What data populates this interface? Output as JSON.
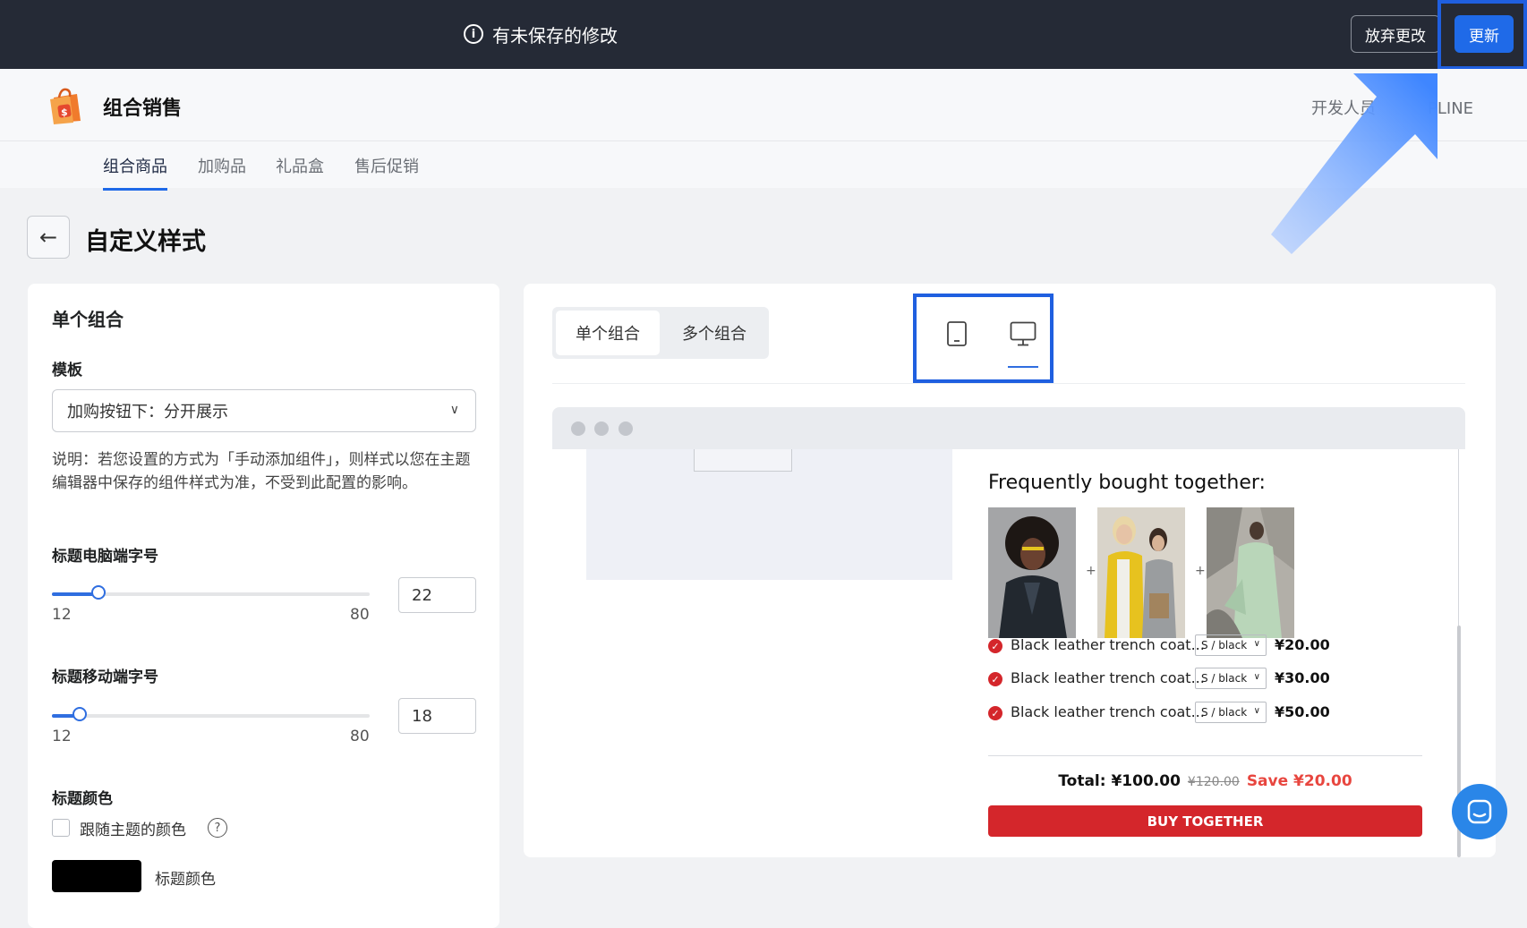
{
  "topbar": {
    "unsaved_message": "有未保存的修改",
    "discard_label": "放弃更改",
    "update_label": "更新"
  },
  "app": {
    "title": "组合销售",
    "developer_text": "开发人员",
    "developer_suffix": "PLINE"
  },
  "tabs": [
    {
      "label": "组合商品",
      "active": true
    },
    {
      "label": "加购品",
      "active": false
    },
    {
      "label": "礼品盒",
      "active": false
    },
    {
      "label": "售后促销",
      "active": false
    }
  ],
  "page": {
    "title": "自定义样式"
  },
  "left_panel": {
    "heading": "单个组合",
    "template_label": "模板",
    "template_value": "加购按钮下：分开展示",
    "help_text": "说明：若您设置的方式为「手动添加组件」，则样式以您在主题编辑器中保存的组件样式为准，不受到此配置的影响。",
    "desktop_size": {
      "label": "标题电脑端字号",
      "min": "12",
      "max": "80",
      "value": "22",
      "min_num": 12,
      "max_num": 80,
      "value_num": 22
    },
    "mobile_size": {
      "label": "标题移动端字号",
      "min": "12",
      "max": "80",
      "value": "18",
      "min_num": 12,
      "max_num": 80,
      "value_num": 18
    },
    "color_label": "标题颜色",
    "follow_theme_label": "跟随主题的颜色",
    "follow_theme_checked": false,
    "swatch_color": "#000000",
    "swatch_label": "标题颜色"
  },
  "preview": {
    "segments": [
      {
        "label": "单个组合",
        "active": true
      },
      {
        "label": "多个组合",
        "active": false
      }
    ],
    "devices": [
      {
        "icon": "mobile-icon",
        "active": false
      },
      {
        "icon": "desktop-icon",
        "active": true
      }
    ],
    "widget": {
      "title": "Frequently bought together:",
      "items": [
        {
          "name": "Black leather trench coat...",
          "variant": "S / black",
          "price": "¥20.00"
        },
        {
          "name": "Black leather trench coat...",
          "variant": "S / black",
          "price": "¥30.00"
        },
        {
          "name": "Black leather trench coat...",
          "variant": "S / black",
          "price": "¥50.00"
        }
      ],
      "total_label": "Total: ¥100.00",
      "original_total": "¥120.00",
      "save_label": "Save ¥20.00",
      "buy_label": "BUY TOGETHER"
    }
  },
  "colors": {
    "accent": "#1f6ae8",
    "buy_button": "#d4262b",
    "save_text": "#e8463f",
    "topbar": "#252a36"
  }
}
